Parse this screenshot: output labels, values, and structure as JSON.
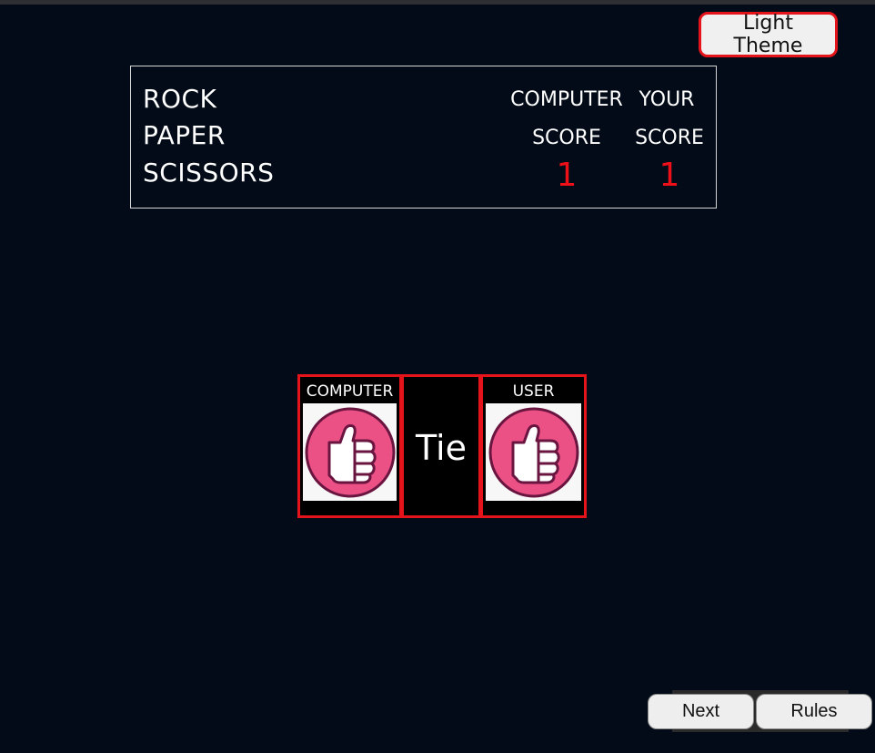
{
  "theme_toggle": {
    "label": "Light Theme"
  },
  "scoreboard": {
    "title_lines": [
      "ROCK",
      "PAPER",
      "SCISSORS"
    ],
    "computer": {
      "heading_line1": "COMPUTER",
      "heading_line2": "SCORE",
      "score": "1"
    },
    "user": {
      "heading_line1": "YOUR",
      "heading_line2": "SCORE",
      "score": "1"
    }
  },
  "round_result": {
    "computer_label": "COMPUTER",
    "computer_choice_icon": "rock-fist-icon",
    "result_text": "Tie",
    "user_label": "USER",
    "user_choice_icon": "rock-fist-icon"
  },
  "footer": {
    "next_label": "Next",
    "rules_label": "Rules"
  },
  "colors": {
    "background": "#020b17",
    "accent_red": "#e5141b",
    "score_red": "#ee1018",
    "fist_pink": "#ec5186",
    "fist_outline": "#6a1540"
  }
}
